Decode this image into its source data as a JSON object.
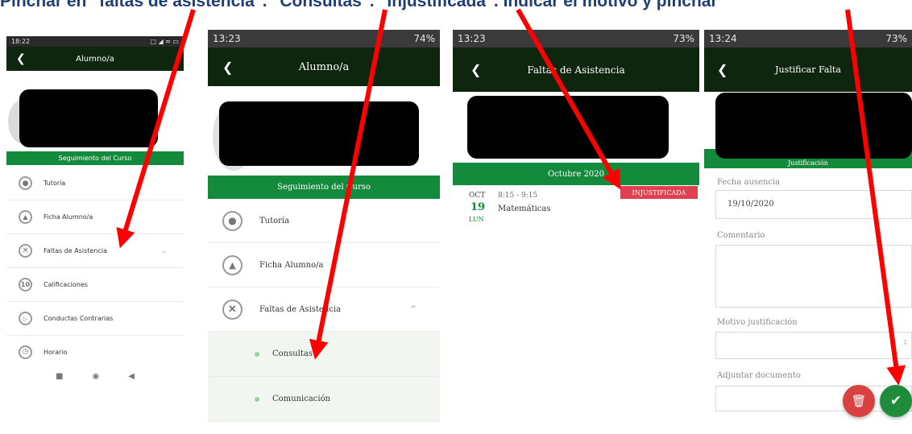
{
  "caption": "Pinchar en \"faltas de asistencia\". \"Consultas\". \"Injustificada\". Indicar el motivo y pinchar",
  "screen1": {
    "time": "18:22",
    "status_icons": "▢ ◢ ≈ ▭",
    "title": "Alumno/a",
    "section": "Seguimiento del Curso",
    "items": [
      {
        "label": "Tutoría",
        "icon": "person-icon"
      },
      {
        "label": "Ficha Alumno/a",
        "icon": "graduation-cap-icon"
      },
      {
        "label": "Faltas de Asistencia",
        "icon": "cross-icon"
      },
      {
        "label": "Calificaciones",
        "icon": "number-ten-icon",
        "glyph": "10"
      },
      {
        "label": "Conductas Contrarias",
        "icon": "warning-icon"
      },
      {
        "label": "Horario",
        "icon": "clock-icon"
      }
    ]
  },
  "screen2": {
    "time": "13:23",
    "battery": "74%",
    "title": "Alumno/a",
    "section": "Seguimiento del Curso",
    "items": [
      {
        "label": "Tutoría",
        "icon": "person-icon"
      },
      {
        "label": "Ficha Alumno/a",
        "icon": "graduation-cap-icon"
      },
      {
        "label": "Faltas de Asistencia",
        "icon": "cross-icon"
      }
    ],
    "subitems": [
      "Consultas",
      "Comunicación"
    ]
  },
  "screen3": {
    "time": "13:23",
    "battery": "73%",
    "title": "Faltas de Asistencia",
    "month": "Octubre 2020",
    "entry": {
      "month": "OCT",
      "day": "19",
      "weekday": "LUN",
      "time": "8:15 - 9:15",
      "subject": "Matemáticas",
      "status": "INJUSTIFICADA"
    }
  },
  "screen4": {
    "time": "13:24",
    "battery": "73%",
    "title": "Justificar Falta",
    "section": "Justificación",
    "fecha_label": "Fecha ausencia",
    "fecha_value": "19/10/2020",
    "comentario_label": "Comentario",
    "motivo_label": "Motivo justificación",
    "adjuntar_label": "Adjuntar documento"
  },
  "colors": {
    "appbar": "#0d260d",
    "green": "#148a3c",
    "red": "#e04050",
    "arrow": "#ff0000"
  }
}
